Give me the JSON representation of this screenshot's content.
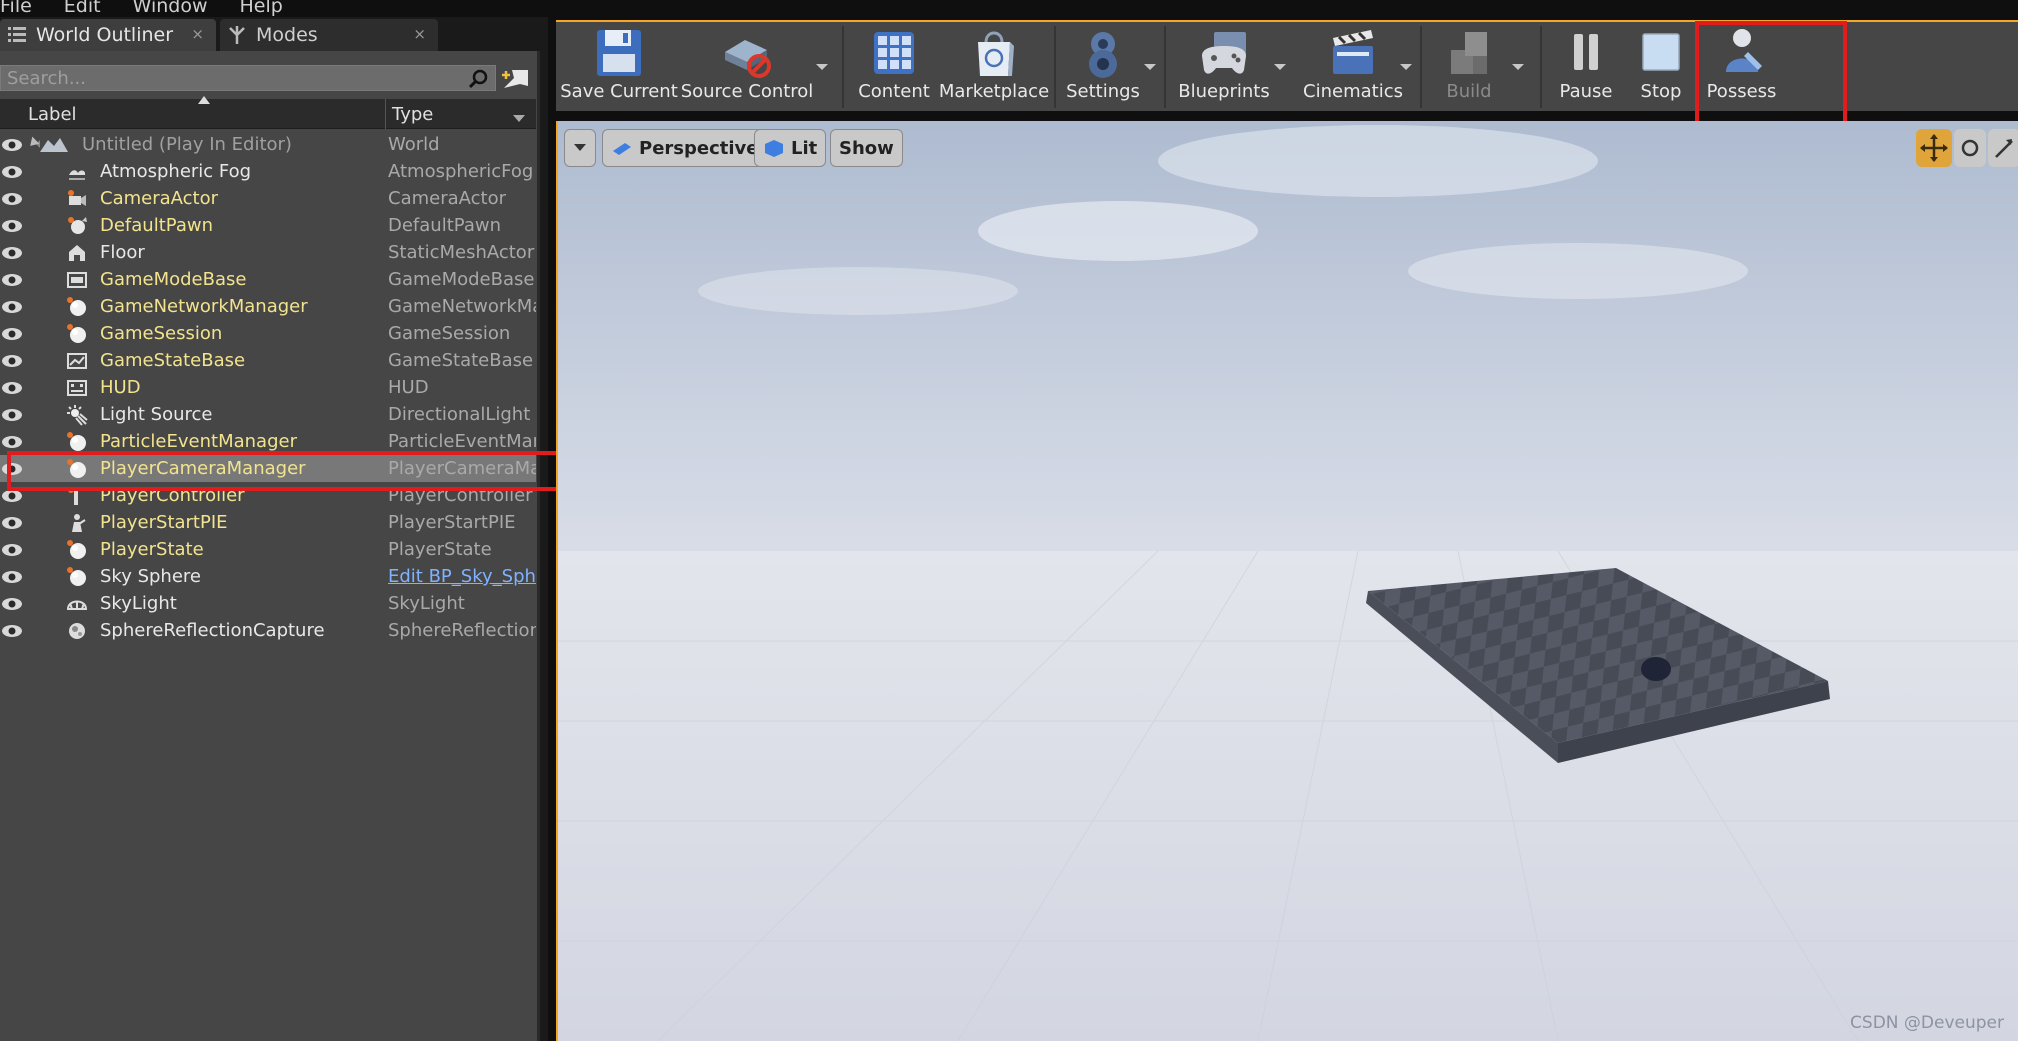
{
  "menubar": {
    "items": [
      "File",
      "Edit",
      "Window",
      "Help"
    ]
  },
  "tabs": {
    "world_outliner": "World Outliner",
    "modes": "Modes",
    "close_glyph": "×"
  },
  "outliner": {
    "search_placeholder": "Search...",
    "col_label": "Label",
    "col_type": "Type",
    "rows": [
      {
        "label": "Untitled (Play In Editor)",
        "type": "World",
        "icon": "world-icon",
        "style": "grey"
      },
      {
        "label": "Atmospheric Fog",
        "type": "AtmosphericFog",
        "icon": "fog-icon",
        "style": "white"
      },
      {
        "label": "CameraActor",
        "type": "CameraActor",
        "icon": "camera-icon",
        "style": "yellow"
      },
      {
        "label": "DefaultPawn",
        "type": "DefaultPawn",
        "icon": "pawn-icon",
        "style": "yellow"
      },
      {
        "label": "Floor",
        "type": "StaticMeshActor",
        "icon": "static-mesh-icon",
        "style": "white"
      },
      {
        "label": "GameModeBase",
        "type": "GameModeBase",
        "icon": "gamemode-icon",
        "style": "yellow"
      },
      {
        "label": "GameNetworkManager",
        "type": "GameNetworkManager",
        "icon": "sphere-icon",
        "style": "yellow"
      },
      {
        "label": "GameSession",
        "type": "GameSession",
        "icon": "sphere-icon",
        "style": "yellow"
      },
      {
        "label": "GameStateBase",
        "type": "GameStateBase",
        "icon": "gamestate-icon",
        "style": "yellow"
      },
      {
        "label": "HUD",
        "type": "HUD",
        "icon": "hud-icon",
        "style": "yellow"
      },
      {
        "label": "Light Source",
        "type": "DirectionalLight",
        "icon": "directional-light-icon",
        "style": "white"
      },
      {
        "label": "ParticleEventManager",
        "type": "ParticleEventManager",
        "icon": "sphere-icon",
        "style": "yellow"
      },
      {
        "label": "PlayerCameraManager",
        "type": "PlayerCameraManager",
        "icon": "sphere-icon",
        "style": "yellow",
        "selected": true
      },
      {
        "label": "PlayerController",
        "type": "PlayerController",
        "icon": "controller-icon",
        "style": "yellow"
      },
      {
        "label": "PlayerStartPIE",
        "type": "PlayerStartPIE",
        "icon": "player-start-icon",
        "style": "yellow"
      },
      {
        "label": "PlayerState",
        "type": "PlayerState",
        "icon": "sphere-icon",
        "style": "yellow"
      },
      {
        "label": "Sky Sphere",
        "type": "Edit BP_Sky_Sphere",
        "icon": "sphere-icon",
        "style": "white",
        "type_link": true
      },
      {
        "label": "SkyLight",
        "type": "SkyLight",
        "icon": "skylight-icon",
        "style": "white"
      },
      {
        "label": "SphereReflectionCapture",
        "type": "SphereReflectionCapture",
        "icon": "reflection-capture-icon",
        "style": "white"
      }
    ]
  },
  "toolbar": {
    "save_current": "Save Current",
    "source_control": "Source Control",
    "content": "Content",
    "marketplace": "Marketplace",
    "settings": "Settings",
    "blueprints": "Blueprints",
    "cinematics": "Cinematics",
    "build": "Build",
    "pause": "Pause",
    "stop": "Stop",
    "possess": "Possess"
  },
  "viewport": {
    "perspective": "Perspective",
    "lit": "Lit",
    "show": "Show"
  },
  "watermark": "CSDN @Deveuper",
  "colors": {
    "highlight": "#e01c1c",
    "accent": "#f5a623",
    "actor_yellow": "#f2e38e",
    "link_blue": "#7fb2ff"
  }
}
